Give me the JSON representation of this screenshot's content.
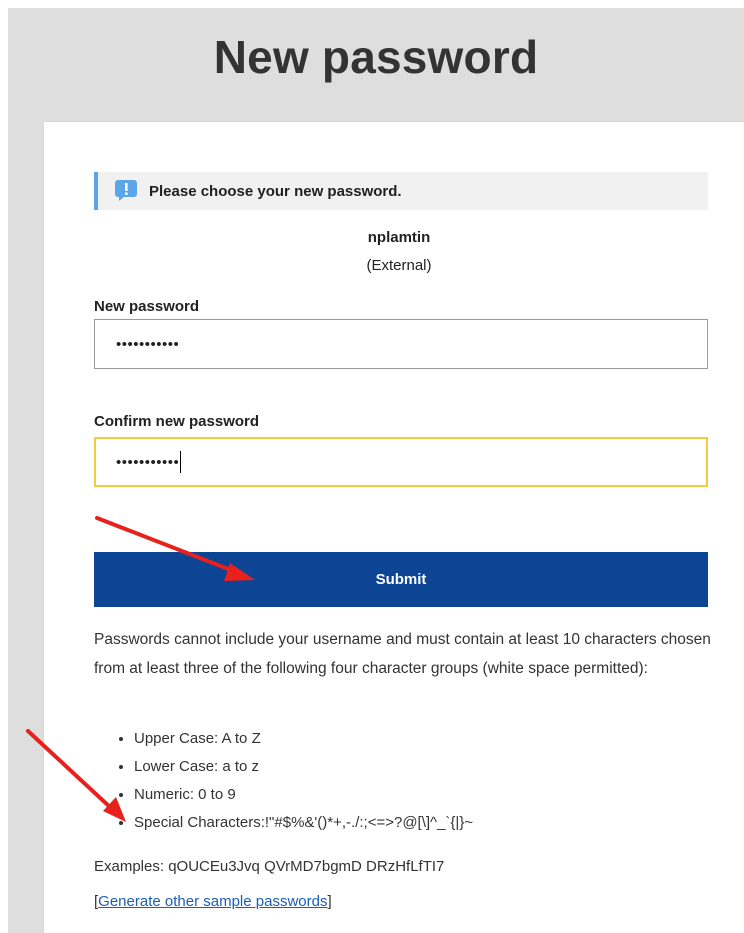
{
  "page": {
    "title": "New password"
  },
  "banner": {
    "icon": "info-exclamation-icon",
    "text": "Please choose your new password."
  },
  "user": {
    "name": "nplamtin",
    "type": "(External)"
  },
  "form": {
    "new_password": {
      "label": "New password",
      "value": "•••••••••••"
    },
    "confirm_password": {
      "label": "Confirm new password",
      "value": "•••••••••••"
    },
    "submit_label": "Submit"
  },
  "rules": {
    "intro": "Passwords cannot include your username and must contain at least 10 characters chosen from at least three of the following four character groups (white space permitted):",
    "groups": [
      "Upper Case: A to Z",
      "Lower Case: a to z",
      "Numeric: 0 to 9",
      "Special Characters:!\"#$%&'()*+,-./:;<=>?@[\\]^_`{|}~"
    ],
    "examples": "Examples: qOUCEu3Jvq QVrMD7bgmD DRzHfLfTI7",
    "generate_prefix": "[",
    "generate_link": "Generate other sample passwords",
    "generate_suffix": "]"
  },
  "colors": {
    "banner_accent": "#5aa6e8",
    "submit_bg": "#0d4494",
    "focus_border": "#f2cc3a",
    "annotation_arrow": "#e8211c",
    "link": "#1a5eb8"
  }
}
